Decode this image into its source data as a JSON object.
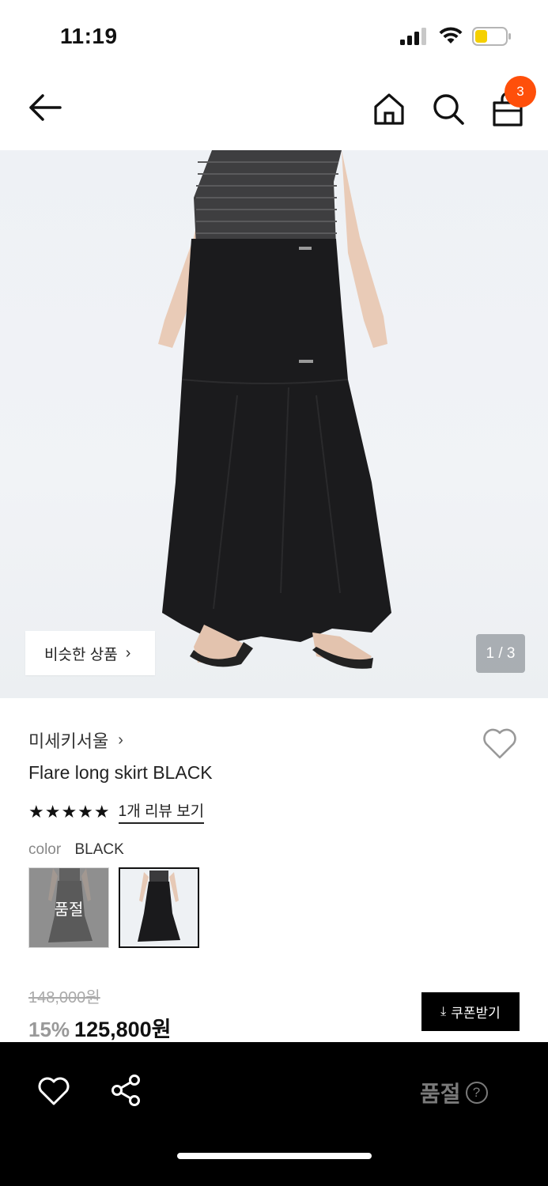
{
  "status_bar": {
    "time": "11:19",
    "battery_color": "#f5d000"
  },
  "nav": {
    "cart_count": "3",
    "badge_color": "#ff4f0a"
  },
  "hero": {
    "similar_label": "비슷한 상품",
    "pager": "1 / 3"
  },
  "product": {
    "brand": "미세키서울",
    "name": "Flare long skirt BLACK",
    "rating_stars": "★★★★★",
    "review_link": "1개 리뷰 보기",
    "color_label": "color",
    "color_value": "BLACK",
    "swatch_soldout": "품절",
    "original_price": "148,000원",
    "discount": "15%",
    "sale_price": "125,800원",
    "coupon_label": "쿠폰받기"
  },
  "bottom_bar": {
    "soldout_label": "품절",
    "help_glyph": "?"
  }
}
